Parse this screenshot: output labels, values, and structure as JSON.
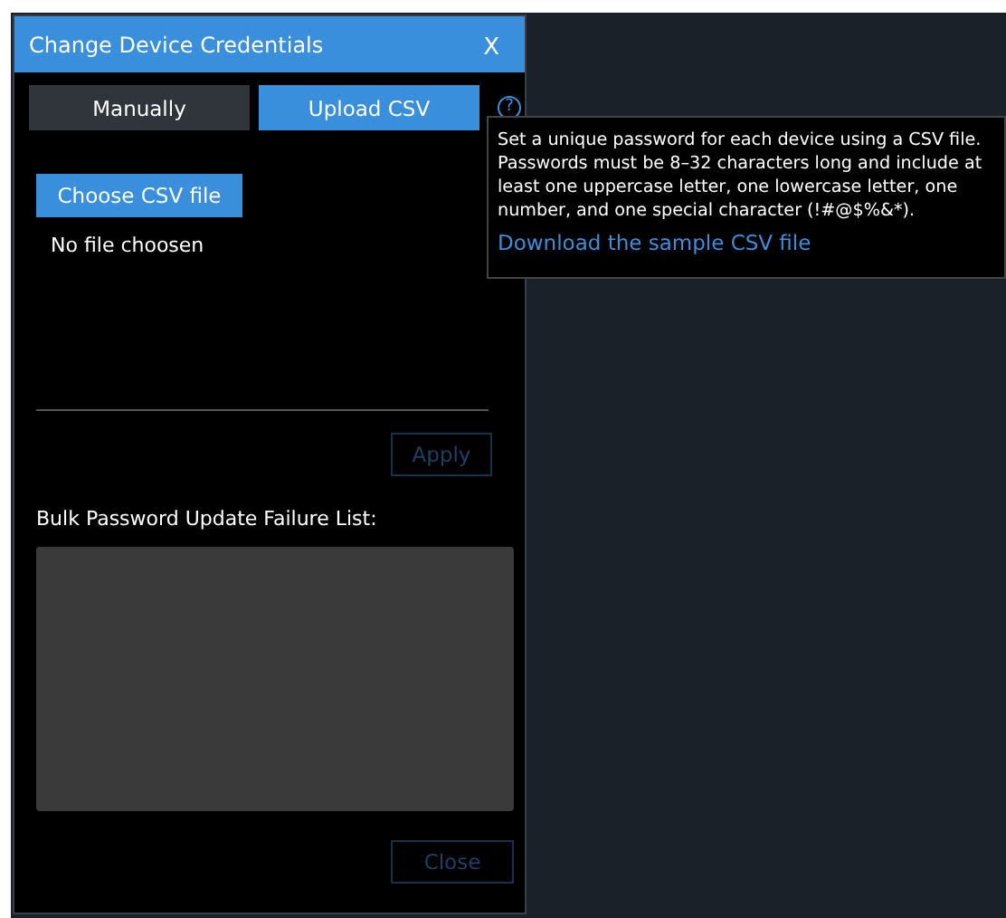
{
  "dialog": {
    "title": "Change Device Credentials",
    "close_label": "X"
  },
  "tabs": [
    {
      "label": "Manually",
      "selected": false
    },
    {
      "label": "Upload CSV",
      "selected": true
    }
  ],
  "help_icon": "?",
  "tooltip": {
    "text": "Set a unique password for each device using a CSV file. Passwords must be 8–32 characters long and include at least one uppercase letter, one lowercase letter, one number, and one special character (!#@$%&*).",
    "link": "Download the sample CSV file"
  },
  "file_button": "Choose CSV file",
  "file_status": "No file choosen",
  "apply_button": {
    "label": "Apply",
    "disabled": true
  },
  "failure_list": {
    "label": "Bulk Password Update Failure List:"
  },
  "close_button": {
    "label": "Close",
    "disabled": true
  }
}
